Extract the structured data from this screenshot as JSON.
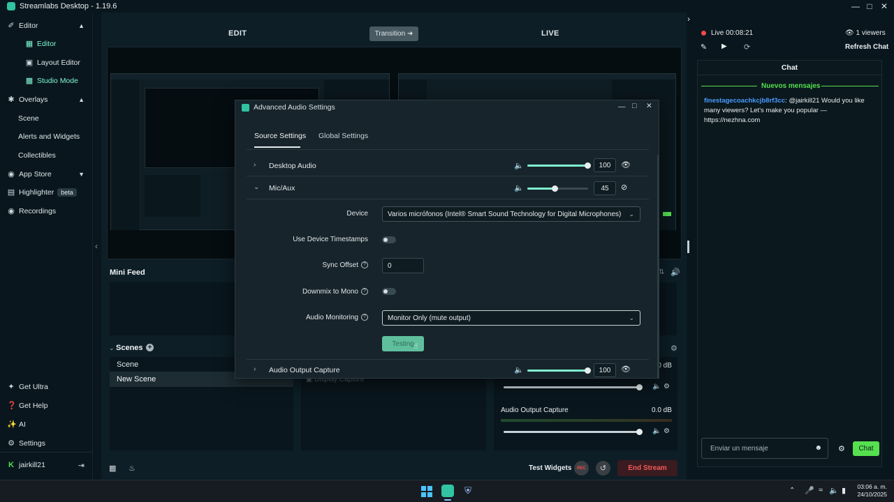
{
  "window": {
    "title": "Streamlabs Desktop - 1.19.6"
  },
  "sidebar": {
    "editor_section": "Editor",
    "items_editor": [
      "Editor",
      "Layout Editor",
      "Studio Mode"
    ],
    "overlays_section": "Overlays",
    "items_overlays": [
      "Scene",
      "Alerts and Widgets",
      "Collectibles"
    ],
    "app_store": "App Store",
    "highlighter": "Highlighter",
    "highlighter_badge": "beta",
    "recordings": "Recordings",
    "bottom": [
      "Get Ultra",
      "Get Help",
      "AI",
      "Settings"
    ],
    "user": "jairkill21"
  },
  "studio": {
    "edit_label": "EDIT",
    "live_label": "LIVE",
    "transition_label": "Transition",
    "mini_feed": "Mini Feed",
    "scenes_title": "Scenes",
    "scenes": [
      "Scene",
      "New Scene"
    ],
    "source_hidden": "Display Capture",
    "mixer_db_top": "0.0 dB",
    "mixer_item": "Audio Output Capture",
    "mixer_item_db": "0.0 dB",
    "test_widgets": "Test Widgets",
    "rec_label": "REC",
    "end_stream": "End Stream"
  },
  "dialog": {
    "title": "Advanced Audio Settings",
    "tabs": [
      "Source Settings",
      "Global Settings"
    ],
    "sources": [
      {
        "name": "Desktop Audio",
        "volume": "100",
        "level": 1.0
      },
      {
        "name": "Mic/Aux",
        "volume": "45",
        "level": 0.45
      },
      {
        "name": "Audio Output Capture",
        "volume": "100",
        "level": 1.0
      }
    ],
    "device_label": "Device",
    "device_value": "Varios micrófonos (Intel® Smart Sound Technology for Digital Microphones)",
    "timestamps_label": "Use Device Timestamps",
    "sync_label": "Sync Offset",
    "sync_value": "0",
    "downmix_label": "Downmix to Mono",
    "monitoring_label": "Audio Monitoring",
    "monitoring_value": "Monitor Only (mute output)",
    "testing_label": "Testing"
  },
  "chat": {
    "status": "Live",
    "timer": "00:08:21",
    "viewers": "1 viewers",
    "refresh": "Refresh Chat",
    "title": "Chat",
    "new_messages": "Nuevos mensajes",
    "msg_user": "finestagecoachkcjb8rf3cc",
    "msg_text": ": @jairkill21 Would you like many viewers? Let's make you popular — https://nezhna.com",
    "input_placeholder": "Enviar un mensaje",
    "send_label": "Chat"
  },
  "taskbar": {
    "time": "03:06 a. m.",
    "date": "24/10/2025"
  },
  "colors": {
    "accent": "#80f5d2",
    "live_red": "#f24a4a",
    "send_green": "#56e04f"
  }
}
